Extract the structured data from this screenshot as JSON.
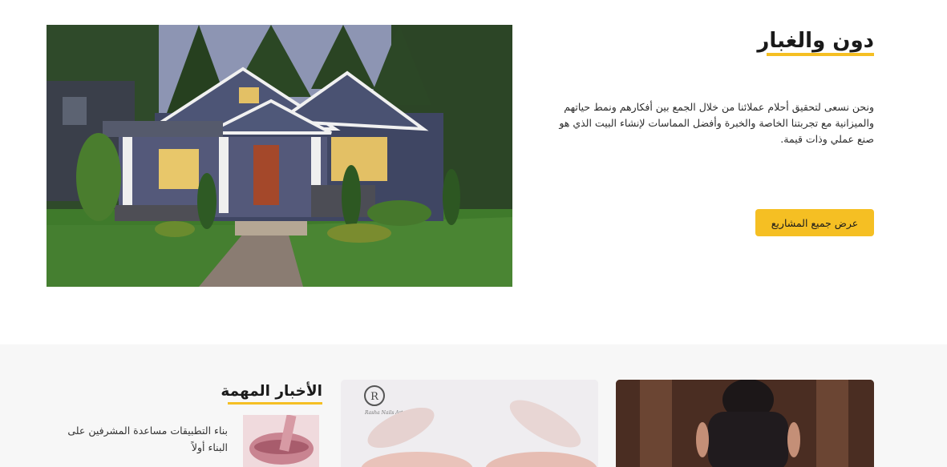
{
  "hero": {
    "title": "دون والغبار",
    "description": "ونحن نسعى لتحقيق أحلام عملائنا من خلال الجمع بين أفكارهم ونمط حياتهم والميزانية مع تجربتنا الخاصة والخبرة وأفضل المماسات لإنشاء البيت الذي هو صنع عملي وذات قيمة.",
    "button_label": "عرض جميع المشاريع",
    "accent_color": "#f5bf23"
  },
  "news": {
    "title": "الأخبار المهمة",
    "items": [
      {
        "text": "بناء التطبيقات مساعدة المشرفين على البناء أولاً"
      }
    ]
  },
  "cards": [
    {
      "logo_letter": "R",
      "logo_caption": "Rasha Nails Art"
    }
  ]
}
